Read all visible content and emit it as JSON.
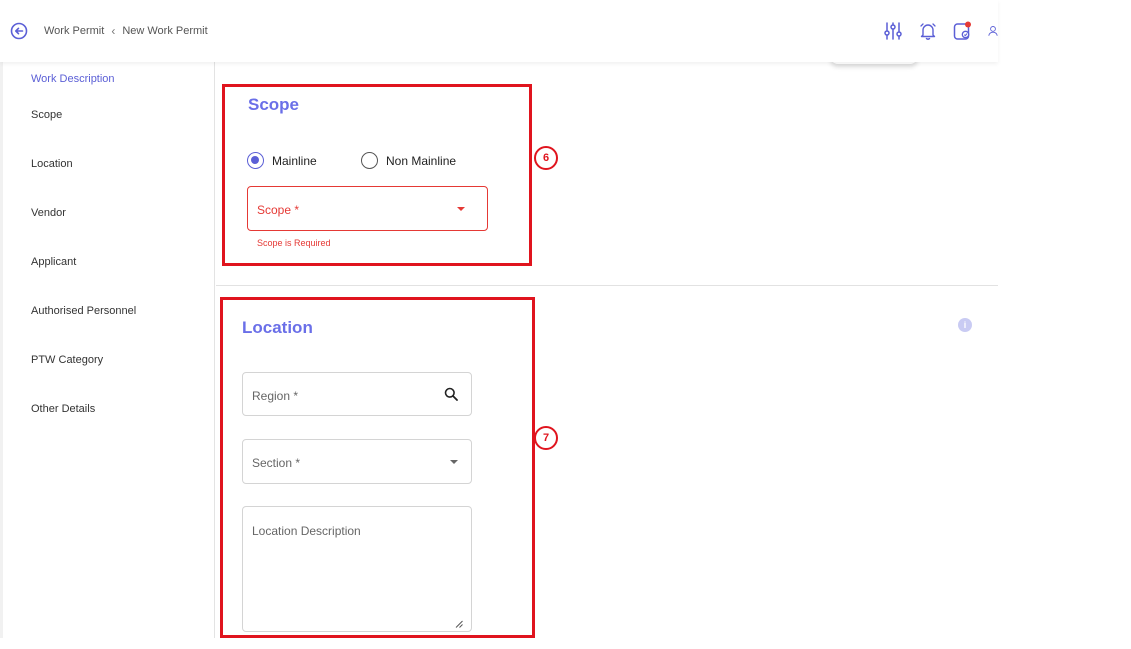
{
  "header": {
    "breadcrumbs": [
      "Work Permit",
      "New Work Permit"
    ],
    "icons": [
      "back-icon",
      "filter-sliders-icon",
      "bell-icon",
      "calendar-notification-icon",
      "user-icon"
    ]
  },
  "sidebar": {
    "items": [
      {
        "label": "Work Description",
        "active": true
      },
      {
        "label": "Scope"
      },
      {
        "label": "Location"
      },
      {
        "label": "Vendor"
      },
      {
        "label": "Applicant"
      },
      {
        "label": "Authorised Personnel"
      },
      {
        "label": "PTW Category"
      },
      {
        "label": "Other Details"
      }
    ]
  },
  "scope": {
    "title": "Scope",
    "radios": [
      {
        "label": "Mainline",
        "checked": true
      },
      {
        "label": "Non Mainline",
        "checked": false
      }
    ],
    "select_placeholder": "Scope *",
    "error": "Scope is Required"
  },
  "location": {
    "title": "Location",
    "region_placeholder": "Region *",
    "section_placeholder": "Section *",
    "description_placeholder": "Location Description"
  },
  "annotations": {
    "scope_badge": "6",
    "location_badge": "7"
  },
  "colors": {
    "accent": "#6a6fe8",
    "error": "#e53935",
    "annotation": "#e0141e"
  }
}
